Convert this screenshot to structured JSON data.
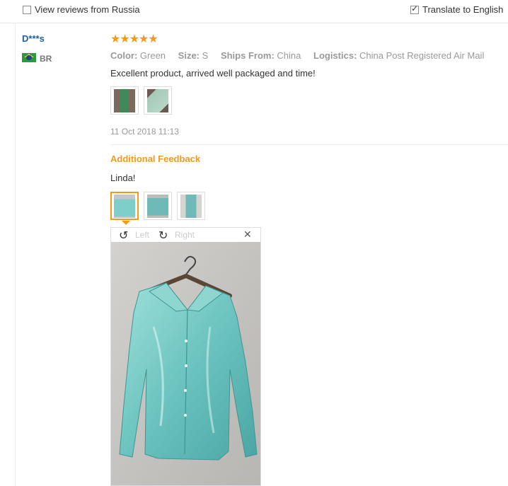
{
  "filters": {
    "view_russia_label": "View reviews from Russia",
    "view_russia_checked": false,
    "translate_label": "Translate to English",
    "translate_checked": true
  },
  "review": {
    "user": "D***s",
    "country": "BR",
    "rating": 5,
    "stars": "★★★★★",
    "attributes": [
      {
        "label": "Color:",
        "value": "Green"
      },
      {
        "label": "Size:",
        "value": "S"
      },
      {
        "label": "Ships From:",
        "value": "China"
      },
      {
        "label": "Logistics:",
        "value": "China Post Registered Air Mail"
      }
    ],
    "text": "Excellent product, arrived well packaged and time!",
    "date": "11 Oct 2018 11:13",
    "additional_title": "Additional Feedback",
    "additional_text": "Linda!"
  },
  "viewer": {
    "left_label": "Left",
    "right_label": "Right",
    "rotate_left_icon": "↺",
    "rotate_right_icon": "↻",
    "close_icon": "✕"
  },
  "colors": {
    "accent": "#f39a17",
    "link": "#1f5ea8",
    "shirt": "#7ecfca"
  }
}
